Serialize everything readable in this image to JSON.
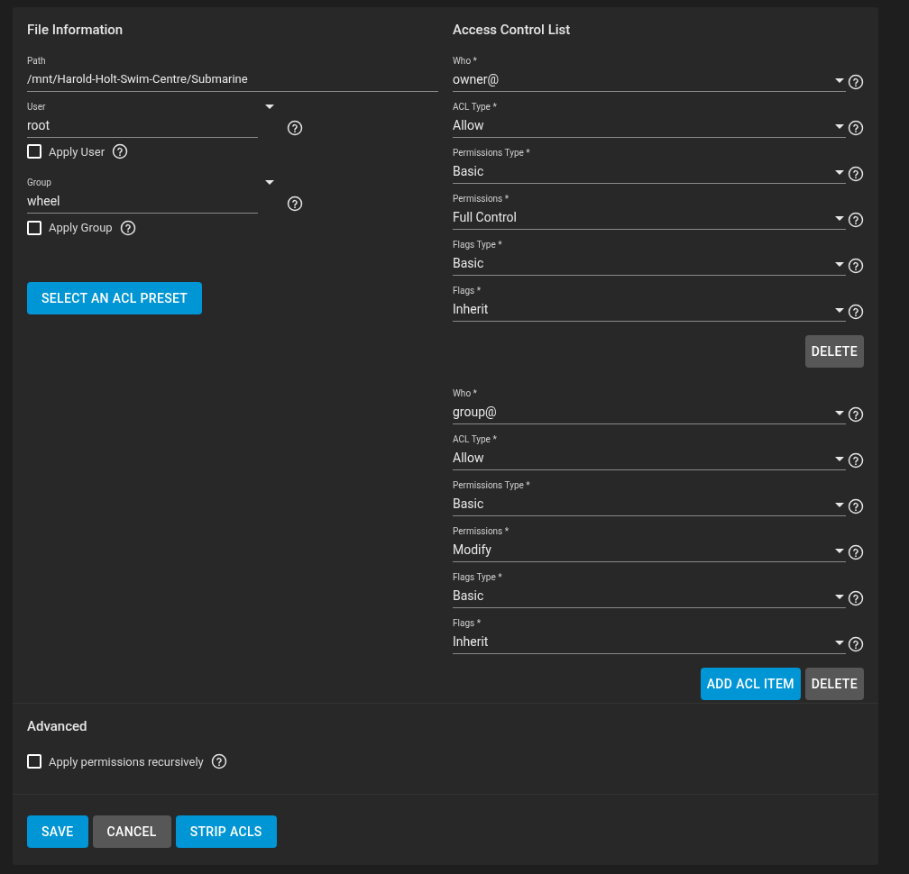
{
  "file_information": {
    "title": "File Information",
    "path": {
      "label": "Path",
      "value": "/mnt/Harold-Holt-Swim-Centre/Submarine"
    },
    "user": {
      "label": "User",
      "value": "root",
      "checkbox": {
        "label": "Apply User",
        "checked": false
      }
    },
    "group": {
      "label": "Group",
      "value": "wheel",
      "checkbox": {
        "label": "Apply Group",
        "checked": false
      }
    },
    "preset_button": {
      "label": "SELECT AN ACL PRESET",
      "kind": "primary"
    }
  },
  "access_control_list": {
    "title": "Access Control List",
    "items": [
      {
        "fields": [
          {
            "label": "Who *",
            "value": "owner@"
          },
          {
            "label": "ACL Type *",
            "value": "Allow"
          },
          {
            "label": "Permissions Type *",
            "value": "Basic"
          },
          {
            "label": "Permissions *",
            "value": "Full Control"
          },
          {
            "label": "Flags Type *",
            "value": "Basic"
          },
          {
            "label": "Flags *",
            "value": "Inherit"
          }
        ],
        "buttons": [
          {
            "label": "DELETE",
            "kind": "secondary"
          }
        ]
      },
      {
        "fields": [
          {
            "label": "Who *",
            "value": "group@"
          },
          {
            "label": "ACL Type *",
            "value": "Allow"
          },
          {
            "label": "Permissions Type *",
            "value": "Basic"
          },
          {
            "label": "Permissions *",
            "value": "Modify"
          },
          {
            "label": "Flags Type *",
            "value": "Basic"
          },
          {
            "label": "Flags *",
            "value": "Inherit"
          }
        ],
        "buttons": [
          {
            "label": "ADD ACL ITEM",
            "kind": "primary"
          },
          {
            "label": "DELETE",
            "kind": "secondary"
          }
        ]
      }
    ]
  },
  "advanced": {
    "title": "Advanced",
    "checkbox": {
      "label": "Apply permissions recursively",
      "checked": false
    }
  },
  "actions": [
    {
      "label": "SAVE",
      "kind": "primary"
    },
    {
      "label": "CANCEL",
      "kind": "secondary"
    },
    {
      "label": "STRIP ACLS",
      "kind": "primary"
    }
  ]
}
